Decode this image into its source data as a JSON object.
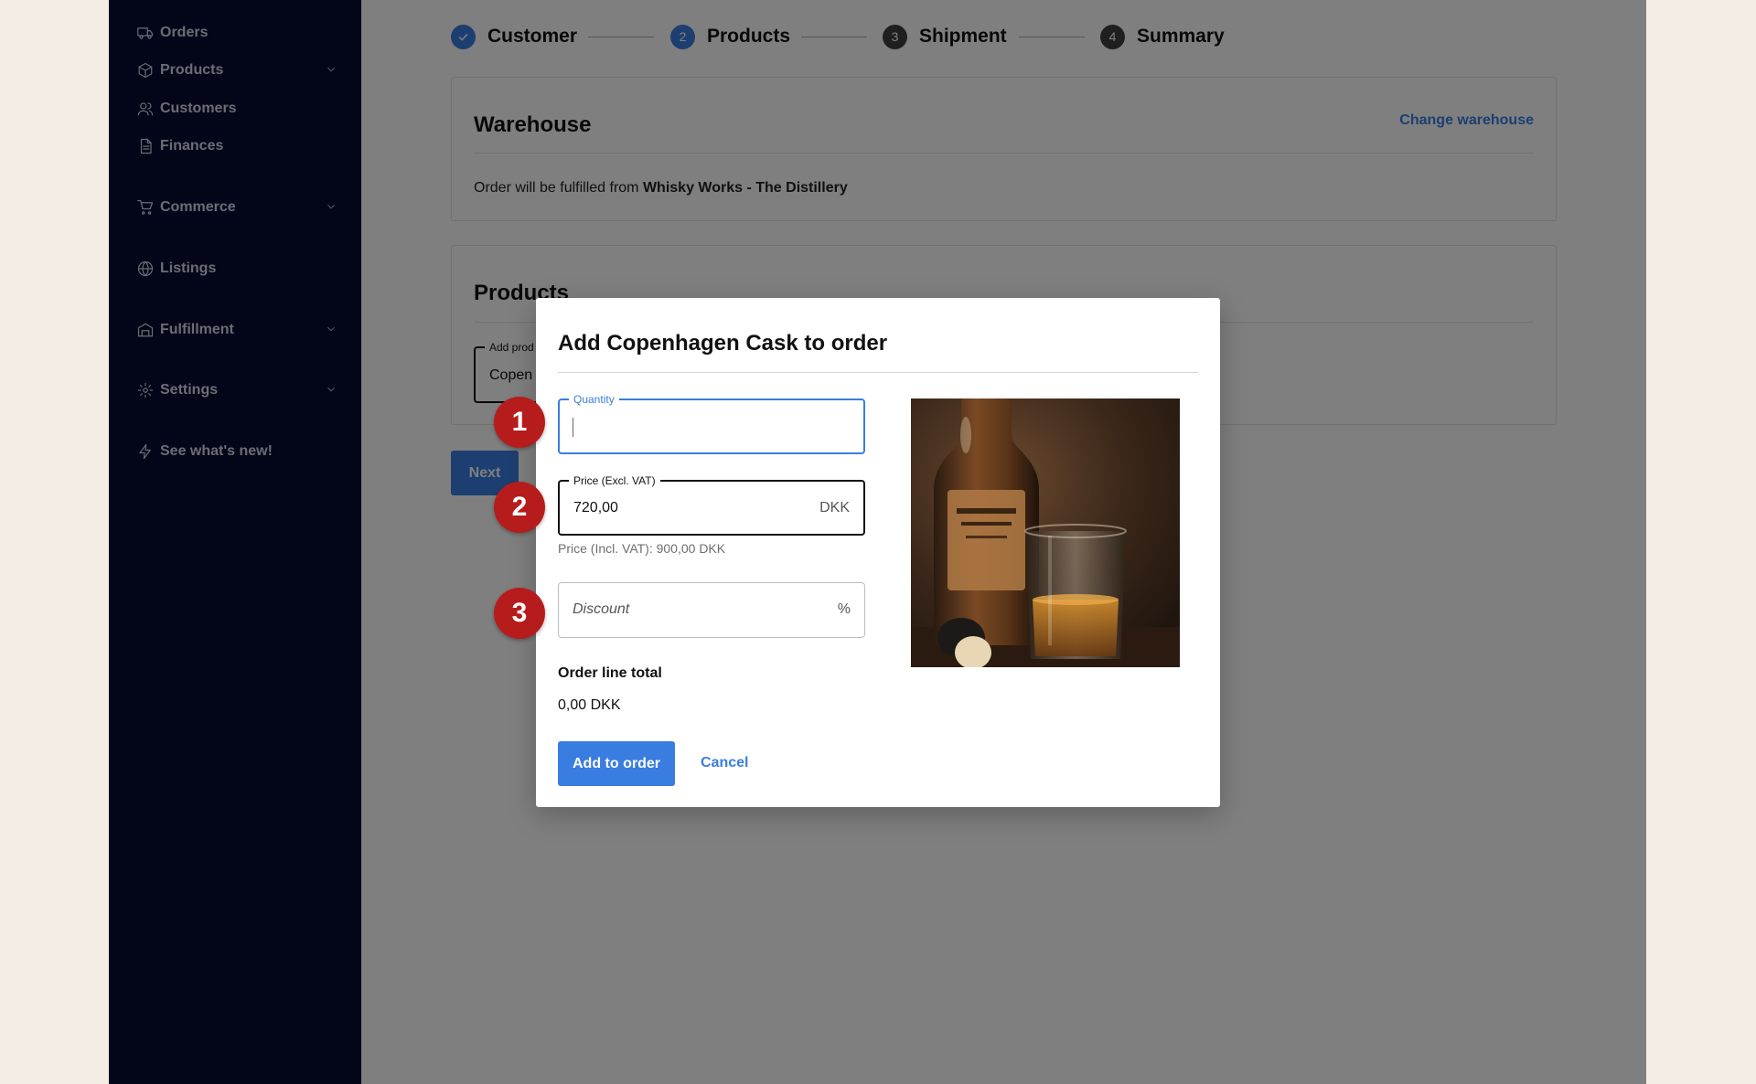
{
  "sidebar": {
    "items": [
      {
        "label": "Orders",
        "icon": "truck-icon",
        "chevron": false
      },
      {
        "label": "Products",
        "icon": "box-icon",
        "chevron": true
      },
      {
        "label": "Customers",
        "icon": "users-icon",
        "chevron": false
      },
      {
        "label": "Finances",
        "icon": "document-icon",
        "chevron": false
      },
      {
        "label": "Commerce",
        "icon": "cart-icon",
        "chevron": true
      },
      {
        "label": "Listings",
        "icon": "globe-icon",
        "chevron": false
      },
      {
        "label": "Fulfillment",
        "icon": "warehouse-icon",
        "chevron": true
      },
      {
        "label": "Settings",
        "icon": "gear-icon",
        "chevron": true
      },
      {
        "label": "See what's new!",
        "icon": "lightning-icon",
        "chevron": false
      }
    ]
  },
  "stepper": {
    "steps": [
      {
        "number": "✓",
        "label": "Customer",
        "state": "completed"
      },
      {
        "number": "2",
        "label": "Products",
        "state": "active"
      },
      {
        "number": "3",
        "label": "Shipment",
        "state": "pending"
      },
      {
        "number": "4",
        "label": "Summary",
        "state": "pending"
      }
    ]
  },
  "warehouse": {
    "title": "Warehouse",
    "change_link": "Change warehouse",
    "text_prefix": "Order will be fulfilled from ",
    "name": "Whisky Works - The Distillery"
  },
  "products_card": {
    "title": "Products",
    "add_product_label": "Add prod",
    "add_product_value": "Copen"
  },
  "next_label": "Next",
  "modal": {
    "title": "Add Copenhagen Cask to order",
    "quantity": {
      "label": "Quantity",
      "value": ""
    },
    "price": {
      "label": "Price (Excl. VAT)",
      "value": "720,00",
      "currency": "DKK"
    },
    "price_hint": "Price (Incl. VAT): 900,00 DKK",
    "discount": {
      "placeholder": "Discount",
      "suffix": "%"
    },
    "line_total_label": "Order line total",
    "line_total_value": "0,00 DKK",
    "add_button": "Add to order",
    "cancel_button": "Cancel"
  },
  "badges": [
    "1",
    "2",
    "3"
  ],
  "colors": {
    "sidebar_bg": "#070a33",
    "accent": "#3a7de0",
    "badge": "#b71c1c",
    "step_done": "#3a7de0",
    "step_pending": "#3f3f3f"
  }
}
